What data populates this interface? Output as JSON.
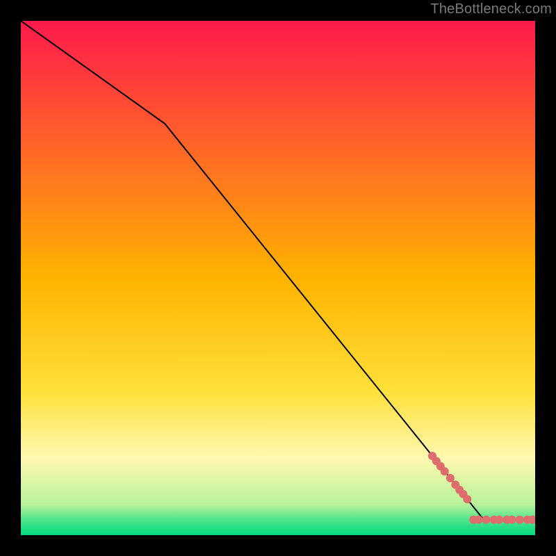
{
  "watermark": "TheBottleneck.com",
  "chart_data": {
    "type": "line",
    "title": "",
    "xlabel": "",
    "ylabel": "",
    "xlim": [
      0,
      100
    ],
    "ylim": [
      0,
      100
    ],
    "background_gradient": {
      "top_color": "#ff1a4d",
      "mid_color": "#ffd633",
      "bottom_color": "#00e673",
      "stops": [
        {
          "offset": 0.0,
          "color": "#ff1a4d"
        },
        {
          "offset": 0.5,
          "color": "#ffb300"
        },
        {
          "offset": 0.72,
          "color": "#ffe039"
        },
        {
          "offset": 0.85,
          "color": "#fff8b0"
        },
        {
          "offset": 0.94,
          "color": "#b8f29a"
        },
        {
          "offset": 0.97,
          "color": "#4fe58c"
        },
        {
          "offset": 1.0,
          "color": "#00d97e"
        }
      ]
    },
    "series": [
      {
        "name": "curve",
        "type": "line",
        "color": "#000000",
        "width": 2,
        "points": [
          {
            "x": 0,
            "y": 100
          },
          {
            "x": 28,
            "y": 80
          },
          {
            "x": 90,
            "y": 3
          },
          {
            "x": 100,
            "y": 3
          }
        ]
      },
      {
        "name": "markers",
        "type": "scatter",
        "color": "#e06d6d",
        "radius": 6,
        "points": [
          {
            "x": 80.0,
            "y": 15.4
          },
          {
            "x": 80.8,
            "y": 14.4
          },
          {
            "x": 81.6,
            "y": 13.4
          },
          {
            "x": 82.4,
            "y": 12.4
          },
          {
            "x": 83.5,
            "y": 11.1
          },
          {
            "x": 84.5,
            "y": 9.8
          },
          {
            "x": 85.3,
            "y": 8.8
          },
          {
            "x": 86.0,
            "y": 8.0
          },
          {
            "x": 86.8,
            "y": 7.0
          },
          {
            "x": 88.0,
            "y": 3.0
          },
          {
            "x": 89.0,
            "y": 3.0
          },
          {
            "x": 90.5,
            "y": 3.0
          },
          {
            "x": 92.0,
            "y": 3.0
          },
          {
            "x": 93.0,
            "y": 3.0
          },
          {
            "x": 94.5,
            "y": 3.0
          },
          {
            "x": 95.5,
            "y": 3.0
          },
          {
            "x": 97.0,
            "y": 3.0
          },
          {
            "x": 98.5,
            "y": 3.0
          },
          {
            "x": 99.5,
            "y": 3.0
          }
        ]
      }
    ]
  }
}
